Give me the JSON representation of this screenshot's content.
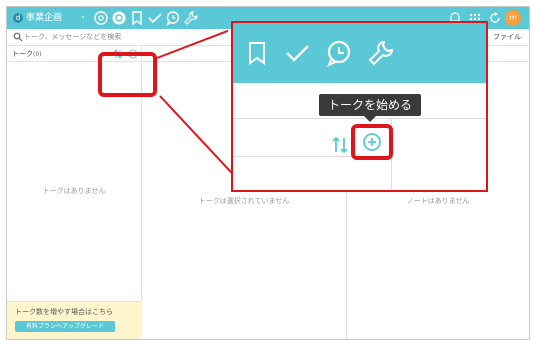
{
  "workspace": {
    "initial": "d",
    "name": "事業企画",
    "caret": "・"
  },
  "topbar": {
    "icons": [
      "mention-icon",
      "chat-icon",
      "bookmark-icon",
      "check-icon",
      "clock-chat-icon",
      "wrench-icon"
    ],
    "right_icons": [
      "bell-icon",
      "apps-grid-icon",
      "refresh-icon"
    ],
    "avatar_initial": "m"
  },
  "search": {
    "placeholder": "トーク、メッセージなどを検索"
  },
  "tabs": {
    "file": "ファイル"
  },
  "talk_column": {
    "title": "トーク",
    "count": "(0)",
    "empty": "トークはありません"
  },
  "message_column": {
    "empty": "トークは選択されていません"
  },
  "note_column": {
    "empty": "ノートはありません"
  },
  "upgrade": {
    "note": "トーク数を増やす場合はこちら",
    "button": "有料プランへアップグレード"
  },
  "tooltip": {
    "label": "トークを始める"
  },
  "colors": {
    "accent": "#5bc8d8",
    "highlight": "#e0151b",
    "upgrade_bg": "#fff5cc",
    "tooltip_bg": "#3a3a3a"
  }
}
